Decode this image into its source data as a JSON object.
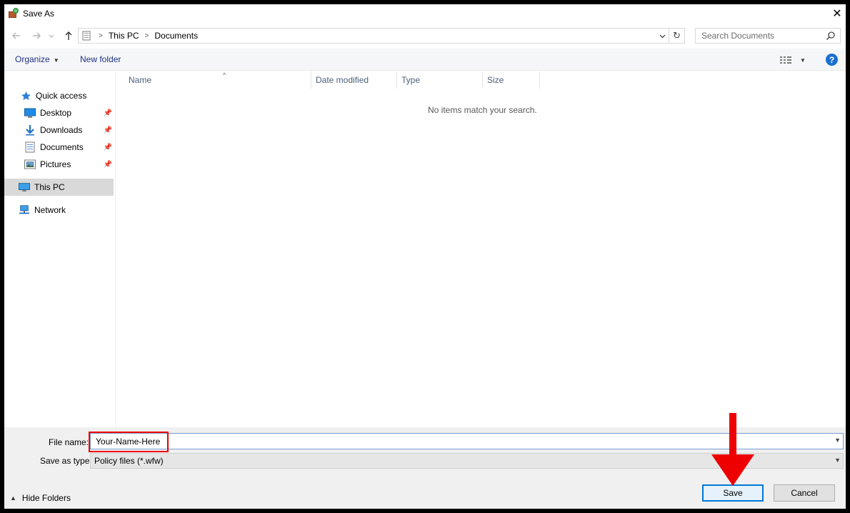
{
  "window": {
    "title": "Save As",
    "close_glyph": "✕"
  },
  "address": {
    "crumbs": [
      "This PC",
      "Documents"
    ],
    "refresh_glyph": "↻"
  },
  "search": {
    "placeholder": "Search Documents"
  },
  "toolbar": {
    "organize_label": "Organize",
    "new_folder_label": "New folder",
    "help_label": "?"
  },
  "nav": {
    "quick_access": "Quick access",
    "items": [
      {
        "label": "Desktop",
        "icon": "desktop-icon",
        "pinned": true
      },
      {
        "label": "Downloads",
        "icon": "download-icon",
        "pinned": true
      },
      {
        "label": "Documents",
        "icon": "document-icon",
        "pinned": true
      },
      {
        "label": "Pictures",
        "icon": "pictures-icon",
        "pinned": true
      }
    ],
    "this_pc": "This PC",
    "network": "Network"
  },
  "columns": {
    "name": "Name",
    "date_modified": "Date modified",
    "type": "Type",
    "size": "Size"
  },
  "content": {
    "empty_message": "No items match your search."
  },
  "form": {
    "file_name_label": "File name:",
    "file_name_value": "Your-Name-Here",
    "save_type_label": "Save as type:",
    "save_type_value": "Policy files (*.wfw)"
  },
  "footer": {
    "hide_folders_label": "Hide Folders",
    "save_label": "Save",
    "cancel_label": "Cancel"
  },
  "colors": {
    "accent": "#0078d7",
    "annotation": "#ee0000",
    "link_blue": "#1e3287"
  }
}
